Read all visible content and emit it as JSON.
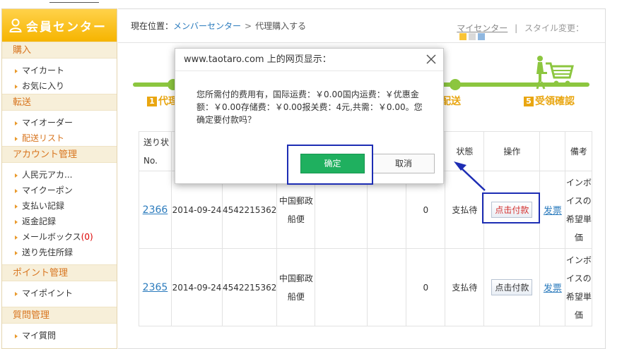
{
  "sidebar": {
    "title": "会員センター",
    "sections": [
      {
        "label": "購入",
        "items": [
          {
            "label": "マイカート"
          },
          {
            "label": "お気に入り"
          }
        ]
      },
      {
        "label": "転送",
        "items": [
          {
            "label": "マイオーダー"
          },
          {
            "label": "配送リスト",
            "active": true
          }
        ]
      },
      {
        "label": "アカウント管理",
        "items": [
          {
            "label": "人民元アカ..."
          },
          {
            "label": "マイクーポン"
          },
          {
            "label": "支払い記録"
          },
          {
            "label": "返金記録"
          },
          {
            "label": "メールボックス",
            "count": "(0)"
          },
          {
            "label": "送り先住所録"
          }
        ]
      },
      {
        "label": "ポイント管理",
        "items": [
          {
            "label": "マイポイント"
          }
        ]
      },
      {
        "label": "質問管理",
        "items": [
          {
            "label": "マイ質問"
          }
        ]
      }
    ]
  },
  "breadcrumb": {
    "prefix": "現在位置：",
    "link": "メンバーセンター",
    "separator": ">",
    "current": "代理購入する"
  },
  "header_right": {
    "my_center": "マイセンター",
    "divider": "|",
    "style_change": "スタイル変更："
  },
  "style_swatches": [
    "#f9c437",
    "#d9d9d9",
    "#8fb7e0"
  ],
  "steps": {
    "first": {
      "num": "1",
      "label": "代理"
    },
    "fourth": {
      "label": "配送"
    },
    "fifth": {
      "num": "5",
      "label": "受領確認"
    }
  },
  "table": {
    "headers": {
      "col1": [
        "送り状",
        "No."
      ],
      "status": "状態",
      "operation": "操作",
      "remarks": "備考"
    },
    "rows": [
      {
        "no": "2366",
        "date": "2014-09-24",
        "tracking": "4542215362",
        "carrier": [
          "中国郵政",
          "船便"
        ],
        "amount": "0",
        "status": "支払待",
        "pay_label": "点击付款",
        "invoice": "发票",
        "remark": [
          "インボ",
          "イスの",
          "希望単",
          "価"
        ]
      },
      {
        "no": "2365",
        "date": "2014-09-24",
        "tracking": "4542215362",
        "carrier": [
          "中国郵政",
          "船便"
        ],
        "amount": "0",
        "status": "支払待",
        "pay_label": "点击付款",
        "invoice": "发票",
        "remark": [
          "インボ",
          "イスの",
          "希望単",
          "価"
        ]
      }
    ]
  },
  "dialog": {
    "title": "www.taotaro.com 上的网页显示：",
    "message": "您所需付的费用有，国际运费：￥0.00国内运费：￥优惠金额：￥0.00存储费：￥0.00报关费：4元,共需：￥0.00。您确定要付款吗？",
    "ok": "确定",
    "cancel": "取消"
  },
  "colors": {
    "accent": "#f6b400",
    "step_green": "#8cc63f",
    "step_label": "#e9a611",
    "confirm_green": "#1fb05f",
    "annotation_blue": "#1d2db4"
  }
}
